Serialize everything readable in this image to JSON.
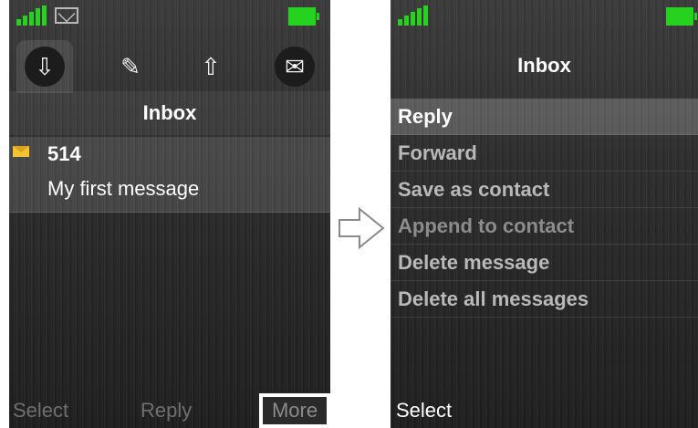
{
  "left_screen": {
    "status": {
      "signal_icon": "signal-bars-icon",
      "message_icon": "envelope-icon",
      "battery_icon": "battery-full-icon"
    },
    "tabs": [
      {
        "name": "inbox-tab",
        "icon": "inbox-download-icon",
        "glyph": "⇩",
        "active": true
      },
      {
        "name": "write-tab",
        "icon": "pencil-note-icon",
        "glyph": "✎",
        "active": false
      },
      {
        "name": "outbox-tab",
        "icon": "outbox-upload-icon",
        "glyph": "⇧",
        "active": false
      },
      {
        "name": "settings-tab",
        "icon": "message-settings-icon",
        "glyph": "✉",
        "active": false
      }
    ],
    "title": "Inbox",
    "message": {
      "from": "514",
      "text": "My first message"
    },
    "softkeys": {
      "left": "Select",
      "middle": "Reply",
      "right": "More"
    }
  },
  "right_screen": {
    "title": "Inbox",
    "menu": [
      {
        "label": "Reply",
        "state": "selected"
      },
      {
        "label": "Forward",
        "state": "normal"
      },
      {
        "label": "Save as contact",
        "state": "normal"
      },
      {
        "label": "Append to contact",
        "state": "dim"
      },
      {
        "label": "Delete message",
        "state": "normal"
      },
      {
        "label": "Delete all messages",
        "state": "normal"
      }
    ],
    "softkeys": {
      "left": "Select"
    }
  },
  "colors": {
    "signal": "#27d11f",
    "battery": "#27d11f",
    "message_envelope": "#f2c233"
  }
}
